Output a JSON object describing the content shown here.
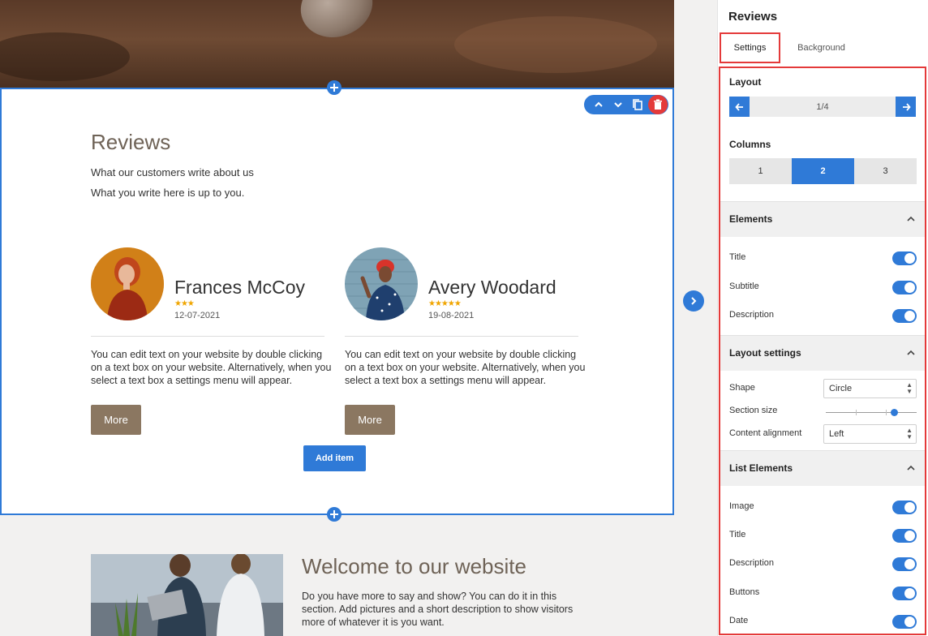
{
  "canvas": {
    "section": {
      "title": "Reviews",
      "subtitle": "What our customers write about us",
      "description": "What you write here is up to you."
    },
    "reviews": [
      {
        "name": "Frances McCoy",
        "stars": "★★★",
        "rating": 3,
        "date": "12-07-2021",
        "text": "You can edit text on your website by double clicking on a text box on your website. Alternatively, when you select a text box a settings menu will appear.",
        "button": "More"
      },
      {
        "name": "Avery Woodard",
        "stars": "★★★★★",
        "rating": 5,
        "date": "19-08-2021",
        "text": "You can edit text on your website by double clicking on a text box on your website. Alternatively, when you select a text box a settings menu will appear.",
        "button": "More"
      }
    ],
    "add_item": "Add item",
    "welcome": {
      "title": "Welcome to our website",
      "text": "Do you have more to say and show? You can do it in this section. Add pictures and a short description to show visitors more of whatever it is you want."
    },
    "toolbar_icons": [
      "chevron-up-icon",
      "chevron-down-icon",
      "copy-icon",
      "trash-icon"
    ]
  },
  "panel": {
    "title": "Reviews",
    "tabs": [
      "Settings",
      "Background"
    ],
    "active_tab": "Settings",
    "layout": {
      "label": "Layout",
      "pager": "1/4"
    },
    "columns": {
      "label": "Columns",
      "options": [
        "1",
        "2",
        "3"
      ],
      "selected": "2"
    },
    "elements": {
      "label": "Elements",
      "items": [
        {
          "label": "Title",
          "on": true
        },
        {
          "label": "Subtitle",
          "on": true
        },
        {
          "label": "Description",
          "on": true
        }
      ]
    },
    "layout_settings": {
      "label": "Layout settings",
      "shape_label": "Shape",
      "shape_value": "Circle",
      "section_size_label": "Section size",
      "section_size_level": 0.75,
      "alignment_label": "Content alignment",
      "alignment_value": "Left"
    },
    "list_elements": {
      "label": "List Elements",
      "items": [
        {
          "label": "Image",
          "on": true
        },
        {
          "label": "Title",
          "on": true
        },
        {
          "label": "Description",
          "on": true
        },
        {
          "label": "Buttons",
          "on": true
        },
        {
          "label": "Date",
          "on": true
        }
      ]
    }
  },
  "colors": {
    "accent": "#2f7ad7",
    "highlight": "#e43a3a",
    "button_brown": "#8b7761",
    "star": "#f0a500"
  }
}
